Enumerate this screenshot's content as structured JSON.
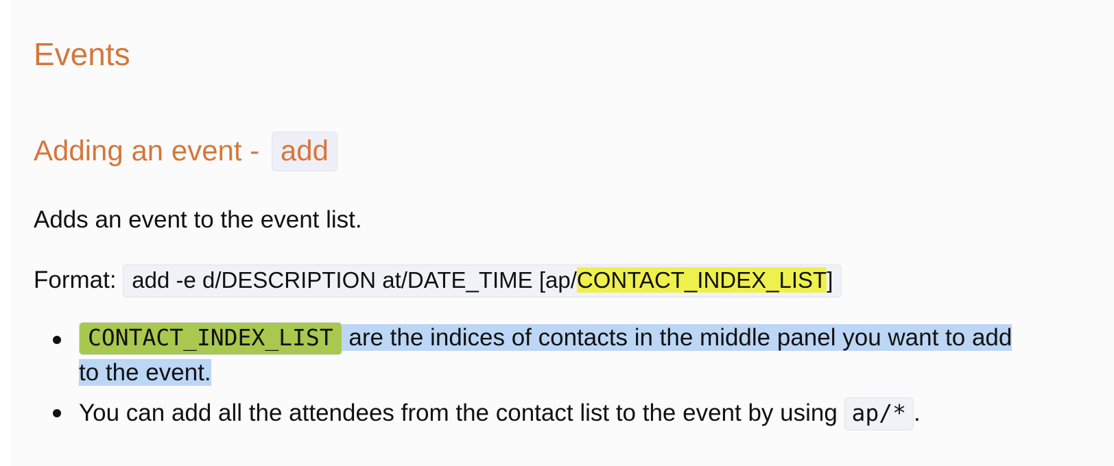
{
  "heading": "Events",
  "section": {
    "title_prefix": "Adding an event - ",
    "title_code": "add"
  },
  "description": "Adds an event to the event list.",
  "format": {
    "label": "Format: ",
    "code_before": "add -e d/DESCRIPTION at/DATE_TIME [ap/",
    "code_highlight": "CONTACT_INDEX_LIST",
    "code_after": "]"
  },
  "bullets": [
    {
      "code": "CONTACT_INDEX_LIST",
      "text_line1": " are the indices of contacts in the middle panel you want to add",
      "text_line2": "to the event."
    },
    {
      "text": "You can add all the attendees from the contact list to the event by using ",
      "code": "ap/*",
      "suffix": "."
    }
  ],
  "colors": {
    "heading": "#d6763a",
    "highlight_yellow": "#eef04d",
    "highlight_green": "#a9c84f",
    "selection": "#bcd6f5"
  }
}
